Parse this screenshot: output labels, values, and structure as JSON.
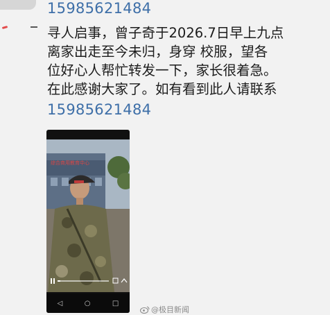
{
  "header": {
    "phone_top": "15985621484"
  },
  "message": {
    "lines": [
      "寻人启事，曾子奇于2026.7日早上九点",
      "离家出走至今未归，身穿   校服，望各",
      "位好心人帮忙转发一下，家长很着急。",
      "在此感谢大家了。如有看到此人请联系"
    ],
    "phone_bottom": "15985621484"
  },
  "video": {
    "building_sign": "综合商用教育中心",
    "nav_back": "◁",
    "nav_home": "○",
    "nav_recent": "□"
  },
  "watermark": {
    "text": "@极目新闻"
  },
  "colors": {
    "link": "#3e6fa8",
    "text": "#1c1c1c",
    "background": "#f2f2f2"
  }
}
